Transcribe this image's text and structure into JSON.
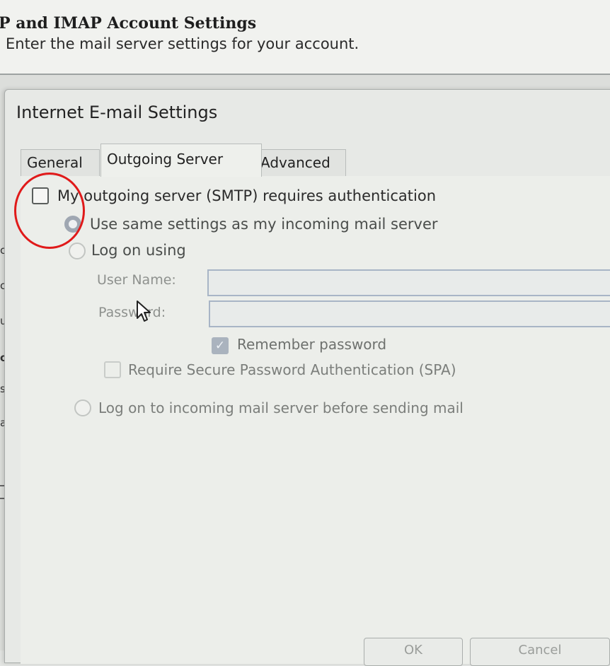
{
  "wizard": {
    "title": "P and IMAP Account Settings",
    "subtitle": "Enter the mail server settings for your account.",
    "left_fragments": [
      "c",
      "c",
      "ut",
      "og",
      "se",
      "as:"
    ]
  },
  "dialog": {
    "title": "Internet E-mail Settings",
    "tabs": [
      "General",
      "Outgoing Server",
      "Advanced"
    ],
    "active_tab": "Outgoing Server",
    "smtp_auth": {
      "label": "My outgoing server (SMTP) requires authentication",
      "checked": false
    },
    "options": {
      "same_settings": "Use same settings as my incoming mail server",
      "log_on_using": "Log on using",
      "log_on_incoming": "Log on to incoming mail server before sending mail"
    },
    "fields": {
      "user_name_label": "User Name:",
      "user_name_value": "",
      "password_label": "Password:",
      "password_value": ""
    },
    "remember_password": "Remember password",
    "spa": "Require Secure Password Authentication (SPA)",
    "buttons": {
      "ok": "OK",
      "cancel": "Cancel"
    }
  },
  "colors": {
    "annotation": "#e01a1a",
    "field_border": "#a8b5c6",
    "selected_radio": "#9fa7b2"
  }
}
